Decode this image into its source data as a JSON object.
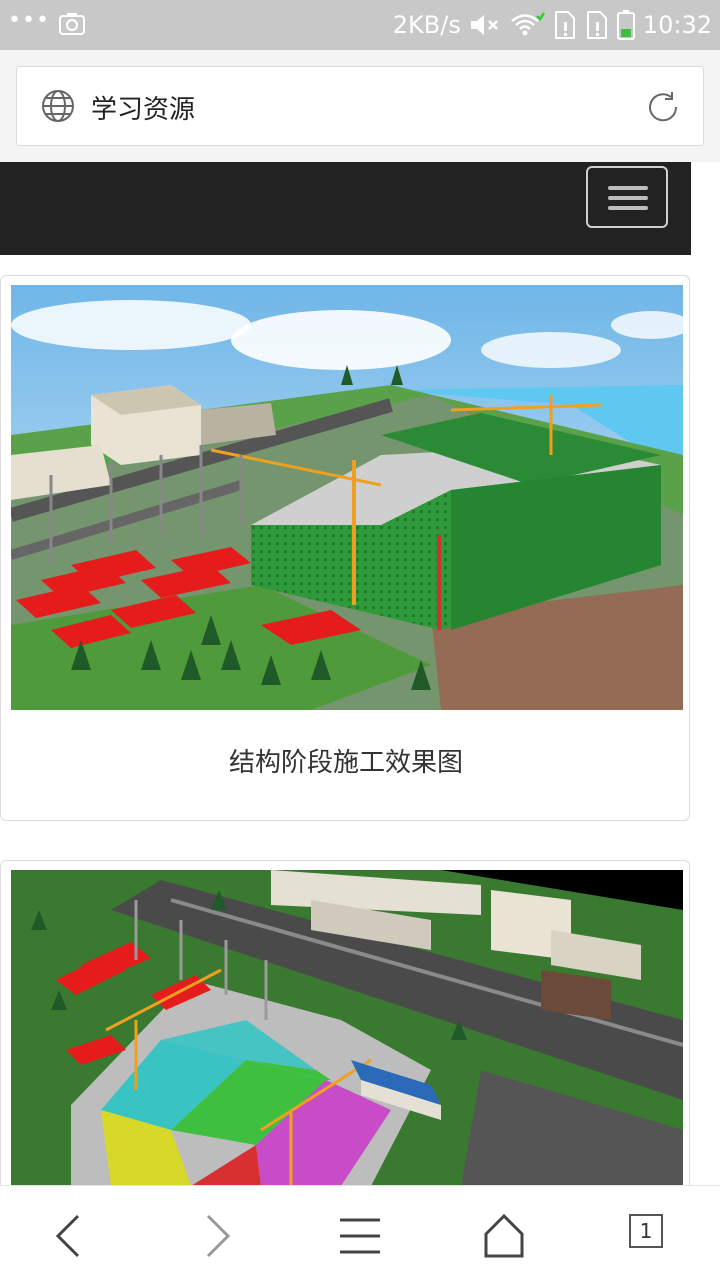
{
  "status_bar": {
    "network_speed": "2KB/s",
    "time": "10:32",
    "icons": [
      "more-dots-icon",
      "screenshot-icon",
      "mute-icon",
      "wifi-icon",
      "sim-alert-icon",
      "sim-alert-icon",
      "battery-icon"
    ]
  },
  "browser": {
    "page_title": "学习资源",
    "tab_count": "1"
  },
  "cards": [
    {
      "caption": "结构阶段施工效果图"
    },
    {
      "caption": ""
    }
  ],
  "colors": {
    "navbar": "#222222",
    "statusbar": "#c8c8c8",
    "building_green": "#2f9a3a",
    "roof_red": "#e61b1b",
    "crane_orange": "#f0a020",
    "sky": "#9fd0f0"
  }
}
